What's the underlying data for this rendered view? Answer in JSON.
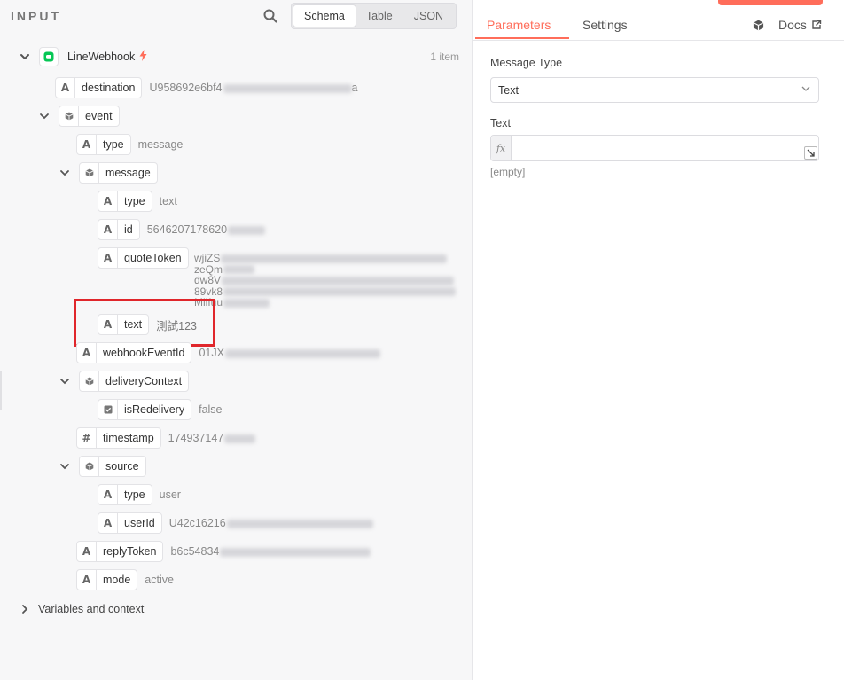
{
  "input_panel": {
    "title": "INPUT",
    "view_modes": [
      "Schema",
      "Table",
      "JSON"
    ],
    "active_view": "Schema",
    "node_name": "LineWebhook",
    "item_count": "1 item",
    "fields": {
      "destination": {
        "name": "destination",
        "value": "U958692e6bf4",
        "tail": "a"
      },
      "event": {
        "name": "event"
      },
      "event_type": {
        "name": "type",
        "value": "message"
      },
      "message": {
        "name": "message"
      },
      "message_type": {
        "name": "type",
        "value": "text"
      },
      "message_id": {
        "name": "id",
        "value": "5646207178620"
      },
      "quote_token": {
        "name": "quoteToken",
        "lines": [
          "wjiZS",
          "zeQm",
          "dw8V",
          "89vk8",
          "Mlifuu"
        ]
      },
      "message_text": {
        "name": "text",
        "value": "測試123"
      },
      "webhook_event_id": {
        "name": "webhookEventId",
        "value": "01JX"
      },
      "delivery_context": {
        "name": "deliveryContext"
      },
      "is_redelivery": {
        "name": "isRedelivery",
        "value": "false"
      },
      "timestamp": {
        "name": "timestamp",
        "value": "174937147"
      },
      "source": {
        "name": "source"
      },
      "source_type": {
        "name": "type",
        "value": "user"
      },
      "user_id": {
        "name": "userId",
        "value": "U42c16216"
      },
      "reply_token": {
        "name": "replyToken",
        "value": "b6c54834"
      },
      "mode": {
        "name": "mode",
        "value": "active"
      }
    },
    "variables_label": "Variables and context"
  },
  "params_panel": {
    "tabs": [
      "Parameters",
      "Settings"
    ],
    "active_tab": "Parameters",
    "docs_label": "Docs",
    "message_type_label": "Message Type",
    "message_type_value": "Text",
    "text_label": "Text",
    "fx_label": "fx",
    "text_value": "",
    "empty_hint": "[empty]"
  },
  "colors": {
    "accent": "#ff6d5a",
    "highlight": "#e0262b",
    "line_green": "#06c755"
  }
}
